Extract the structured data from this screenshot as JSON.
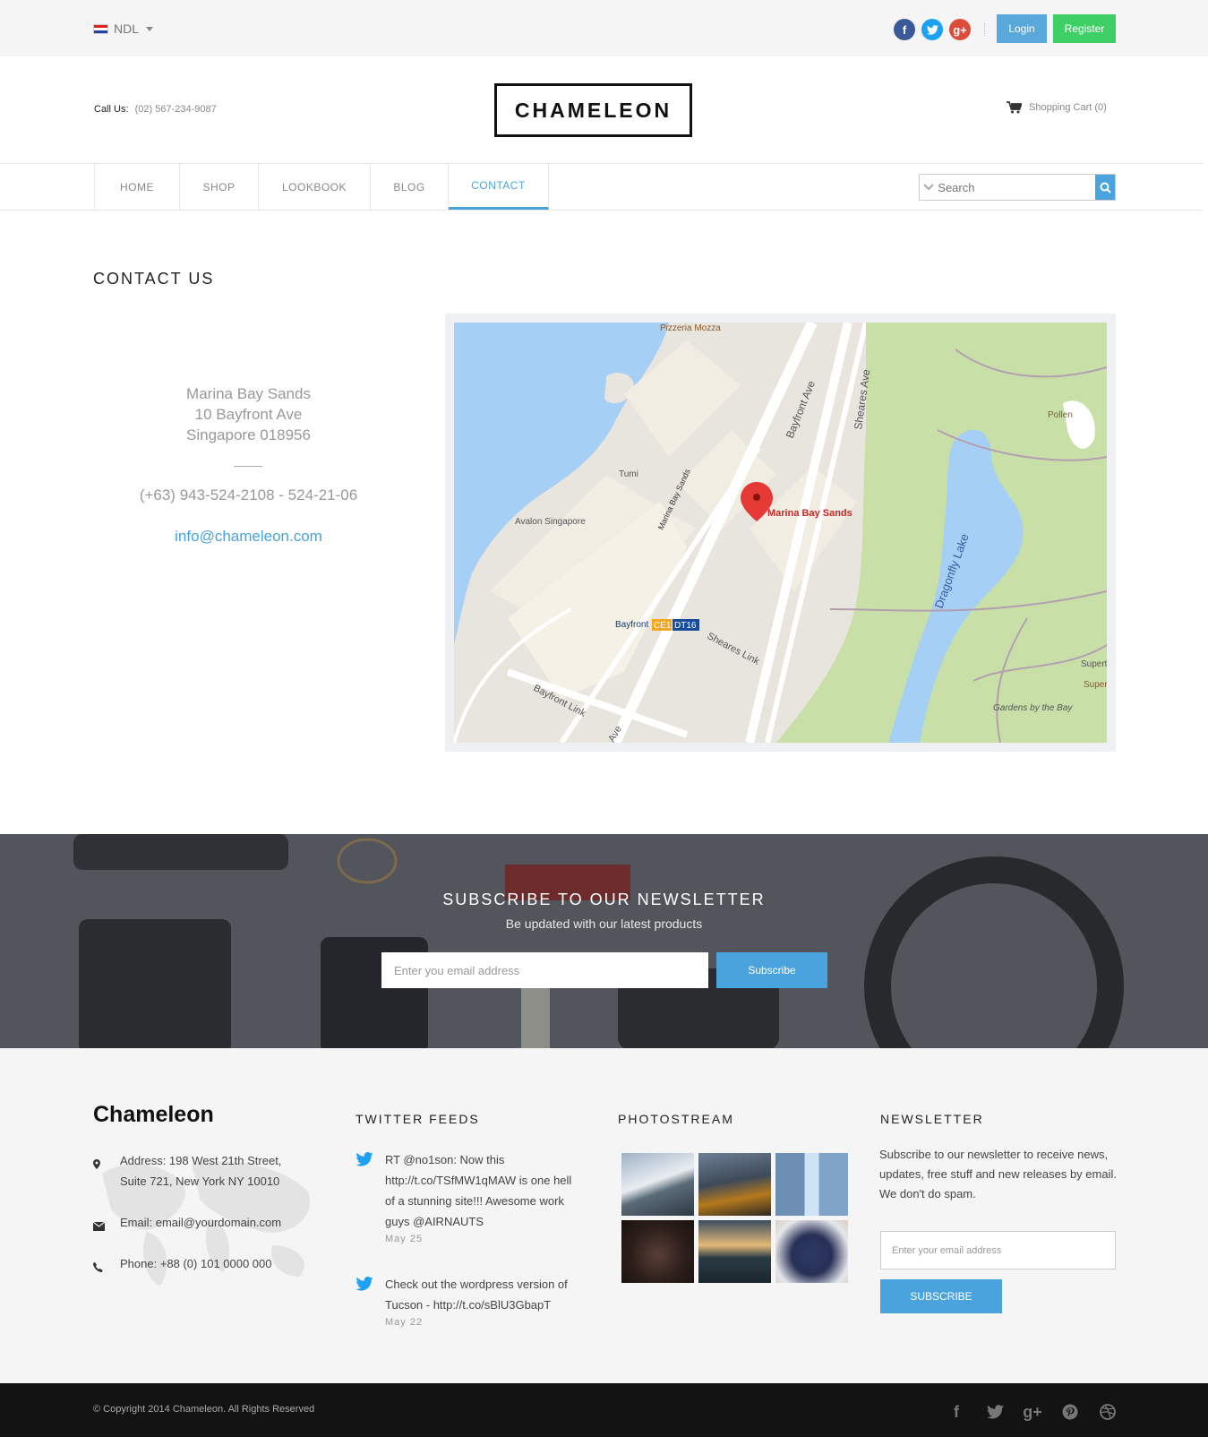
{
  "topbar": {
    "language": "NDL",
    "socials": [
      {
        "name": "facebook-icon",
        "glyph": "f"
      },
      {
        "name": "twitter-icon",
        "glyph": "t"
      },
      {
        "name": "googleplus-icon",
        "glyph": "g+"
      }
    ],
    "login_label": "Login",
    "register_label": "Register"
  },
  "header": {
    "call_label": "Call Us:",
    "call_number": "(02) 567-234-9087",
    "logo": "CHAMELEON",
    "cart_label": "Shopping Cart (0)"
  },
  "nav": {
    "items": [
      {
        "label": "HOME"
      },
      {
        "label": "SHOP"
      },
      {
        "label": "LOOKBOOK"
      },
      {
        "label": "BLOG"
      },
      {
        "label": "CONTACT",
        "active": true
      }
    ],
    "search_placeholder": "Search"
  },
  "contact": {
    "title": "CONTACT US",
    "address_line1": "Marina Bay Sands",
    "address_line2": "10 Bayfront Ave",
    "address_line3": "Singapore 018956",
    "phone": "(+63) 943-524-2108 - 524-21-06",
    "email": "info@chameleon.com"
  },
  "map": {
    "labels": {
      "pizzeria": "Pizzeria Mozza",
      "bayfront_ave": "Bayfront Ave",
      "sheares_ave": "Sheares Ave",
      "pollen": "Pollen",
      "tumi": "Tumi",
      "marina_bay_sands_street": "Marina Bay Sands",
      "marker_label": "Marina Bay Sands",
      "avalon": "Avalon Singapore",
      "dragonfly": "Dragonfly Lake",
      "bayfront_station": "Bayfront",
      "ce1": "CE1",
      "dt16": "DT16",
      "sheares_link": "Sheares Link",
      "bayfront_link": "Bayfront Link",
      "ave": "Ave",
      "supertr": "Supertr",
      "super": "Super",
      "gardens": "Gardens by the Bay"
    }
  },
  "banner": {
    "title": "SUBSCRIBE TO OUR NEWSLETTER",
    "subtitle": "Be updated with our latest products",
    "input_placeholder": "Enter you email address",
    "button_label": "Subscribe"
  },
  "footer": {
    "brand": "Chameleon",
    "address_line1": "Address: 198 West 21th Street,",
    "address_line2": "Suite 721, New York NY 10010",
    "email": "Email: email@yourdomain.com",
    "phone": "Phone: +88 (0) 101 0000 000",
    "twitter_title": "TWITTER FEEDS",
    "tweets": [
      {
        "text": "RT @no1son: Now this http://t.co/TSfMW1qMAW is one hell of a stunning site!!! Awesome work guys @AIRNAUTS",
        "date": "May 25"
      },
      {
        "text": "Check out the wordpress version of Tucson - http://t.co/sBlU3GbapT",
        "date": "May 22"
      }
    ],
    "photostream_title": "PHOTOSTREAM",
    "newsletter_title": "NEWSLETTER",
    "newsletter_text": "Subscribe to our newsletter to receive news, updates, free stuff and new releases by email. We don't do spam.",
    "newsletter_placeholder": "Enter your email address",
    "newsletter_button": "SUBSCRIBE"
  },
  "bottom": {
    "copyright": "© Copyright 2014 Chameleon. All Rights Reserved",
    "socials": [
      {
        "name": "facebook-icon",
        "glyph": "f"
      },
      {
        "name": "twitter-icon",
        "glyph": "t"
      },
      {
        "name": "googleplus-icon",
        "glyph": "g+"
      },
      {
        "name": "pinterest-icon",
        "glyph": "p"
      },
      {
        "name": "dribbble-icon",
        "glyph": "d"
      }
    ]
  }
}
